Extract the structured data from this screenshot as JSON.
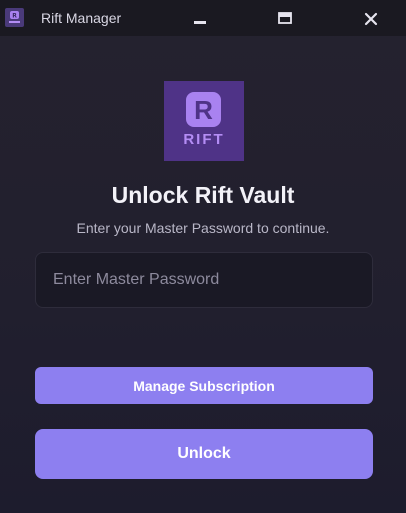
{
  "window": {
    "title": "Rift Manager",
    "icons": {
      "app": "rift-app-icon",
      "minimize": "minimize-icon",
      "maximize": "maximize-icon",
      "close": "close-icon"
    }
  },
  "logo": {
    "letter": "R",
    "word": "RIFT"
  },
  "unlock_form": {
    "heading": "Unlock Rift Vault",
    "subheading": "Enter your Master Password to continue.",
    "password_placeholder": "Enter Master Password",
    "password_value": "",
    "manage_button_label": "Manage Subscription",
    "unlock_button_label": "Unlock"
  },
  "colors": {
    "accent": "#8d7ff0",
    "logo_background": "#4f3387",
    "logo_letter": "#a982f0",
    "titlebar": "#1a1921",
    "window_background": "#221f2e"
  }
}
